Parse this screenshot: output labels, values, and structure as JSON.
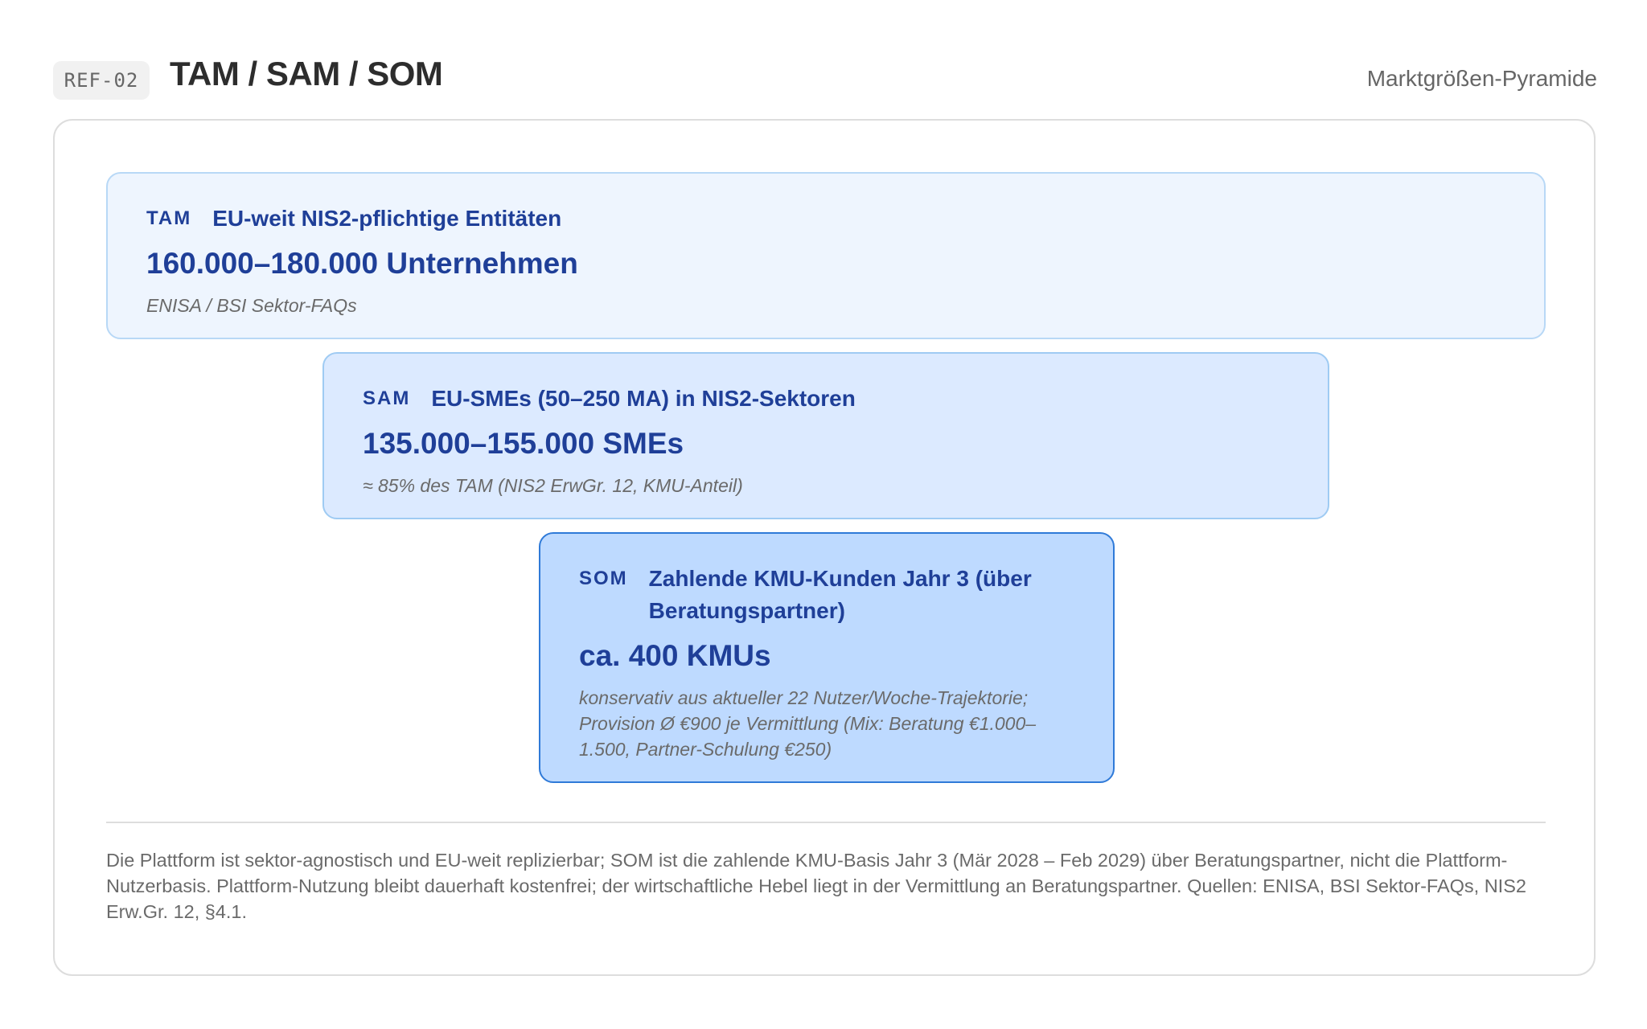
{
  "header": {
    "ref": "REF-02",
    "title": "TAM / SAM / SOM",
    "subtitle": "Marktgrößen-Pyramide"
  },
  "tiers": [
    {
      "label": "TAM",
      "description": "EU-weit NIS2-pflichtige Entitäten",
      "value": "160.000–180.000 Unternehmen",
      "source": "ENISA / BSI Sektor-FAQs"
    },
    {
      "label": "SAM",
      "description": "EU-SMEs (50–250 MA) in NIS2-Sektoren",
      "value": "135.000–155.000 SMEs",
      "source": "≈ 85% des TAM (NIS2 ErwGr. 12, KMU-Anteil)"
    },
    {
      "label": "SOM",
      "description": "Zahlende KMU-Kunden Jahr 3 (über Beratungspartner)",
      "value": "ca. 400 KMUs",
      "source": "konservativ aus aktueller 22 Nutzer/Woche-Trajektorie; Provision Ø €900 je Vermittlung (Mix: Beratung €1.000–1.500, Partner-Schulung €250)"
    }
  ],
  "footnote": "Die Plattform ist sektor-agnostisch und EU-weit replizierbar; SOM ist die zahlende KMU-Basis Jahr 3 (Mär 2028 – Feb 2029) über Beratungspartner, nicht die Plattform-Nutzerbasis. Plattform-Nutzung bleibt dauerhaft kostenfrei; der wirtschaftliche Hebel liegt in der Vermittlung an Beratungspartner. Quellen: ENISA, BSI Sektor-FAQs, NIS2 Erw.Gr. 12, §4.1.",
  "colors": {
    "tam_fill": "#eef5fe",
    "sam_fill": "#dceaff",
    "som_fill": "#bedaff",
    "accent_text": "#1f3f98"
  }
}
